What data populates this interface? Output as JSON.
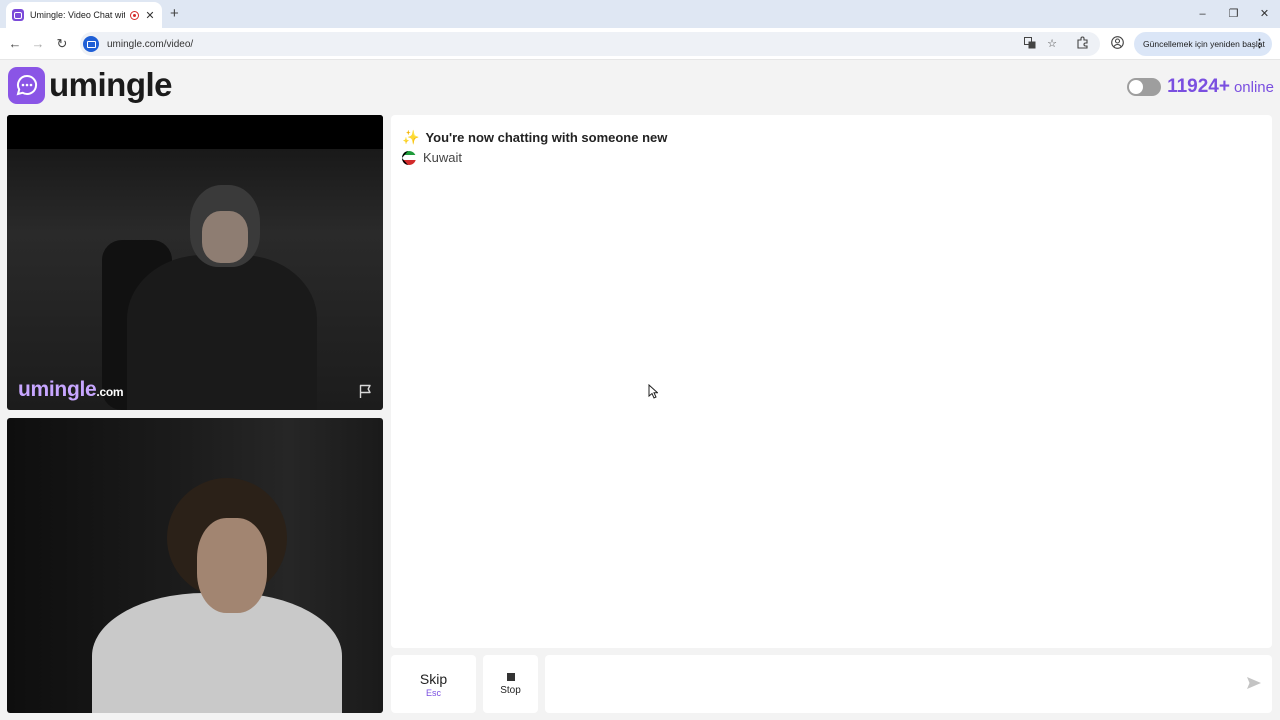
{
  "browser": {
    "tab_title": "Umingle: Video Chat with S",
    "tab_close": "✕",
    "new_tab": "+",
    "url": "umingle.com/video/",
    "update_button": "Güncellemek için yeniden başlat",
    "window_controls": [
      "–",
      "❐",
      "✕"
    ]
  },
  "header": {
    "logo_text": "umingle",
    "online_count": "11924+",
    "online_label": "online"
  },
  "remote_video": {
    "watermark": "umingle",
    "watermark_suffix": ".com",
    "report_icon": "flag-icon"
  },
  "chat": {
    "status_message": "You're now chatting with someone new",
    "country": "Kuwait",
    "message_placeholder": ""
  },
  "controls": {
    "skip_label": "Skip",
    "skip_key": "Esc",
    "stop_label": "Stop"
  },
  "colors": {
    "accent": "#7a4fe0",
    "logo_bg": "#8a55e6",
    "watermark": "#c7a6ff"
  }
}
